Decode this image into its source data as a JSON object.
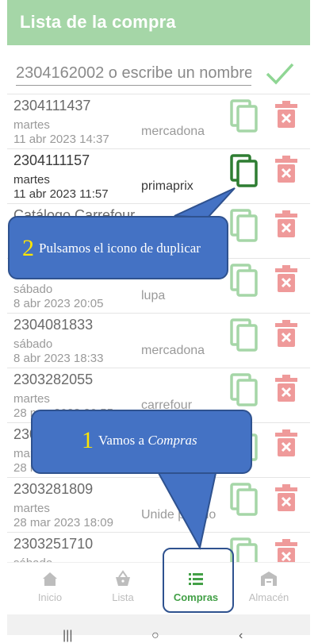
{
  "app": {
    "title": "Lista de la compra"
  },
  "search": {
    "placeholder": "2304162002 o escribe un nombre"
  },
  "rows": [
    {
      "code": "2304111437",
      "day": "martes",
      "date": "11 abr 2023 14:37",
      "shop": "mercadona",
      "dark": false
    },
    {
      "code": "2304111157",
      "day": "martes",
      "date": "11 abr 2023 11:57",
      "shop": "primaprix",
      "dark": true
    },
    {
      "code": "Catálogo Carrefour",
      "day": "",
      "date": "",
      "shop": "",
      "dark": false
    },
    {
      "code": "",
      "day": "sábado",
      "date": "8 abr 2023 20:05",
      "shop": "lupa",
      "dark": false
    },
    {
      "code": "2304081833",
      "day": "sábado",
      "date": "8 abr 2023 18:33",
      "shop": "mercadona",
      "dark": false
    },
    {
      "code": "2303282055",
      "day": "martes",
      "date": "28 mar 2023 20:55",
      "shop": "carrefour",
      "dark": false
    },
    {
      "code": "2303281954",
      "day": "martes",
      "date": "28 mar 2023 19:54",
      "shop": "",
      "dark": false
    },
    {
      "code": "2303281809",
      "day": "martes",
      "date": "28 mar 2023 18:09",
      "shop": "Unide pueblo",
      "dark": false
    },
    {
      "code": "2303251710",
      "day": "sábado",
      "date": "",
      "shop": "",
      "dark": false
    }
  ],
  "nav": [
    {
      "label": "Inicio",
      "icon": "home-icon",
      "active": false
    },
    {
      "label": "Lista",
      "icon": "basket-icon",
      "active": false
    },
    {
      "label": "Compras",
      "icon": "list-icon",
      "active": true
    },
    {
      "label": "Almacén",
      "icon": "warehouse-icon",
      "active": false
    }
  ],
  "callouts": {
    "duplicate": {
      "num": "2",
      "text": "Pulsamos el icono de duplicar"
    },
    "purchases": {
      "num": "1",
      "text_prefix": "Vamos a ",
      "text_em": "Compras"
    }
  },
  "colors": {
    "appbar": "#a5d6a7",
    "accent": "#43a047",
    "delete": "#ef9a9a",
    "callout": "#4472c4",
    "callout_number": "#ffe600"
  }
}
